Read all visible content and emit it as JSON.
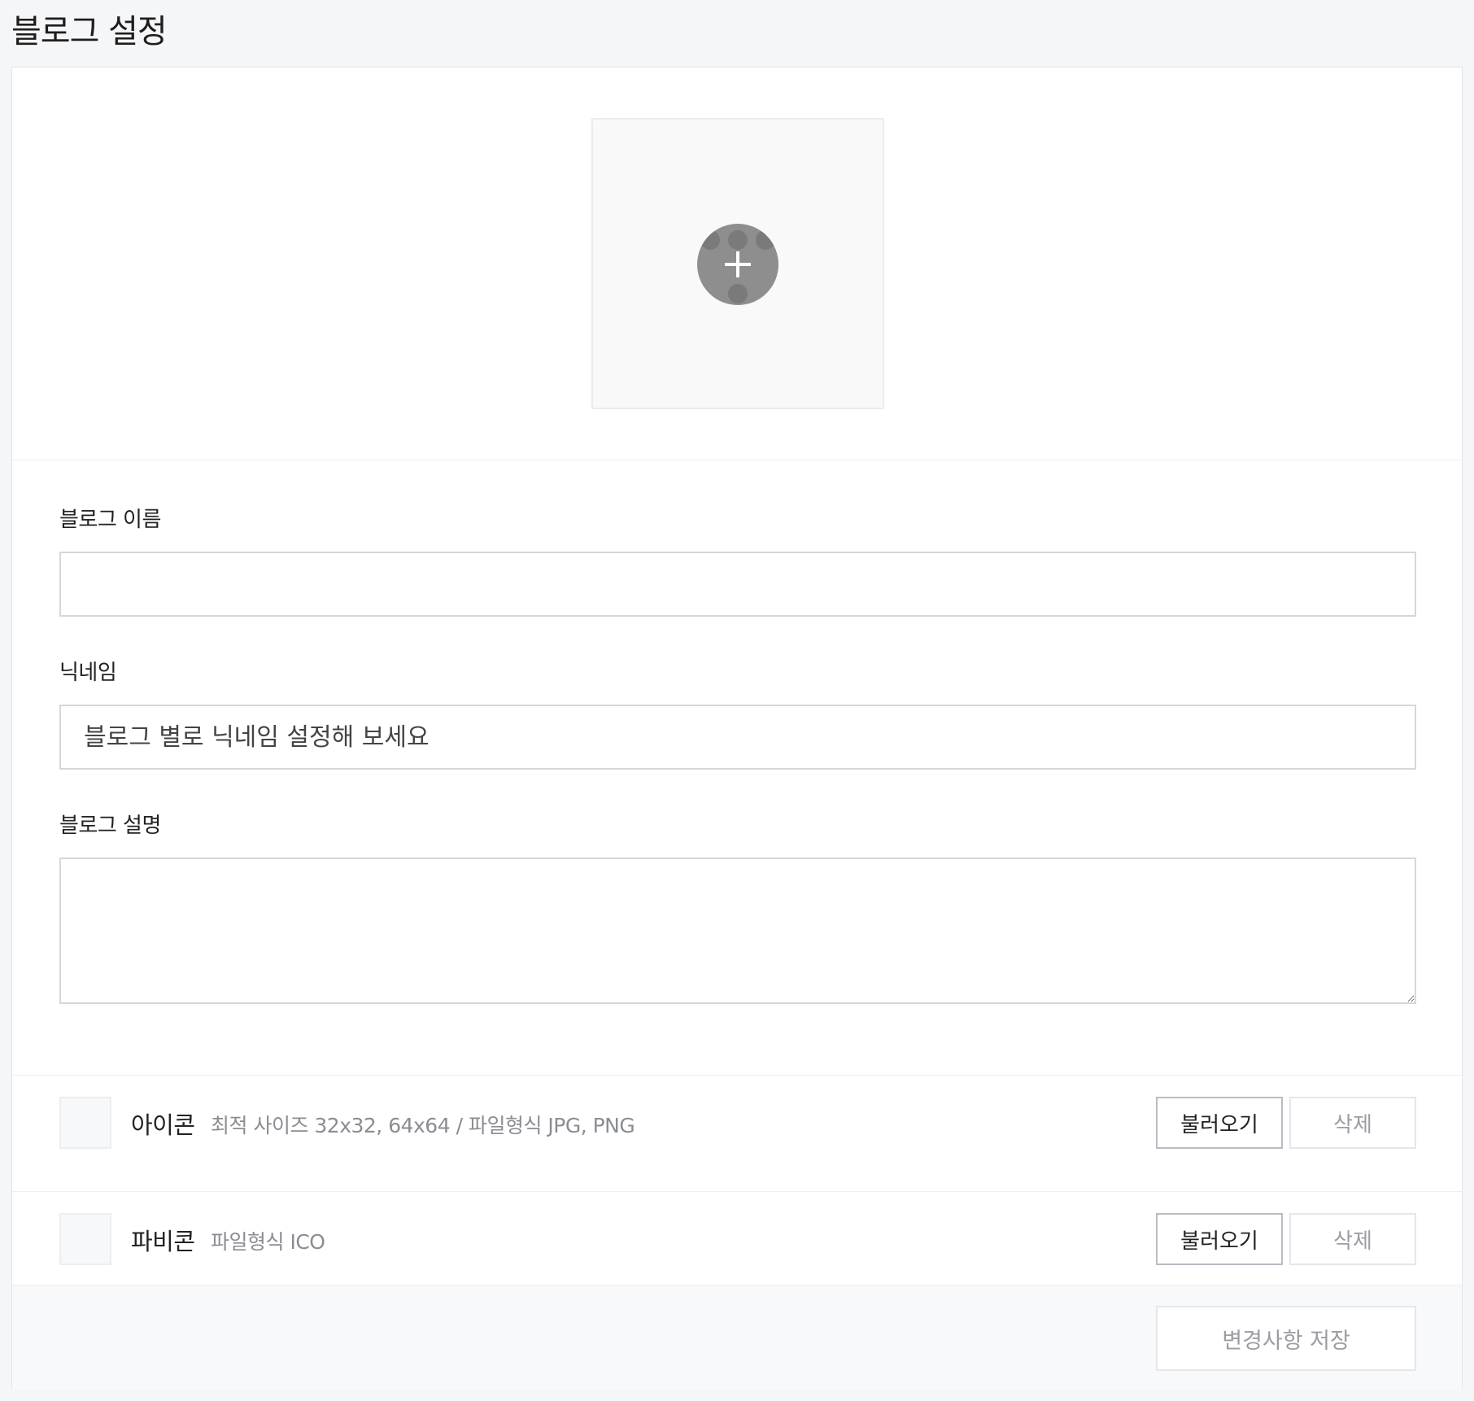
{
  "page": {
    "title": "블로그 설정"
  },
  "cover": {
    "add_icon": "plus-icon"
  },
  "form": {
    "blog_name": {
      "label": "블로그 이름",
      "value": "",
      "placeholder": ""
    },
    "nickname": {
      "label": "닉네임",
      "value": "",
      "placeholder": "블로그 별로 닉네임 설정해 보세요"
    },
    "description": {
      "label": "블로그 설명",
      "value": ""
    }
  },
  "icon_row": {
    "title": "아이콘",
    "hint": "최적 사이즈 32x32, 64x64 / 파일형식 JPG, PNG",
    "load_label": "불러오기",
    "delete_label": "삭제"
  },
  "favicon_row": {
    "title": "파비콘",
    "hint": "파일형식 ICO",
    "load_label": "불러오기",
    "delete_label": "삭제"
  },
  "footer": {
    "save_label": "변경사항 저장"
  }
}
